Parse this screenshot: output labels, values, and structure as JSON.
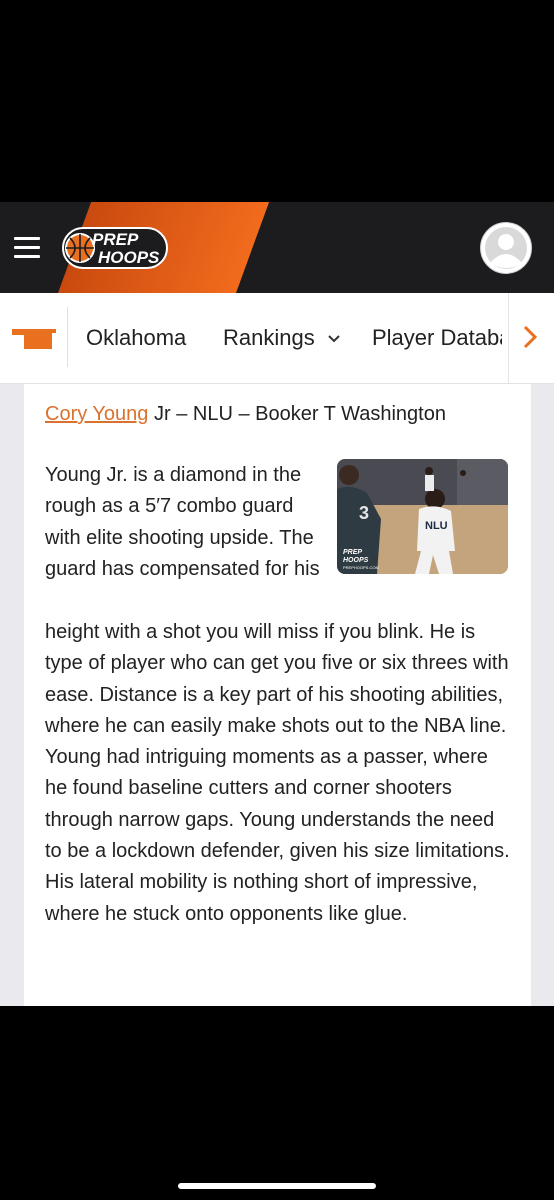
{
  "header": {
    "logo_line1": "PREP",
    "logo_line2": "HOOPS",
    "brand_color": "#f26b1d"
  },
  "nav": {
    "items": [
      "Oklahoma",
      "Rankings",
      "Player Database"
    ],
    "more_icon": "chevron-right"
  },
  "article": {
    "player_name": "Cory Young",
    "player_info": " Jr – NLU – Booker T Washington",
    "photo_watermark_1": "PREP",
    "photo_watermark_2": "HOOPS",
    "photo_watermark_url": "PREPHOOPS.COM",
    "jersey_front": "NLU",
    "jersey_number": "3",
    "paragraph_part1": "Young Jr. is a diamond in the rough as a 5′7 combo guard with elite shooting upside. The guard has compensated for his",
    "paragraph_part2": "height with a shot you will miss if you blink. He is type of player who can get you five or six threes with ease. Distance is a key part of his shooting abilities, where he can easily make shots out to the NBA line. Young had intriguing moments as a passer, where he found baseline cutters and corner shooters through narrow gaps. Young understands the need to be a lockdown defender, given his size limitations. His lateral mobility is nothing short of impressive, where he stuck onto opponents like glue."
  }
}
